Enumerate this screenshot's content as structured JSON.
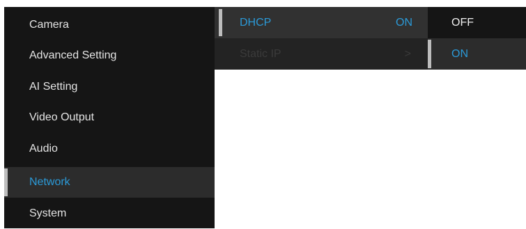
{
  "main_menu": {
    "items": [
      {
        "label": "Camera"
      },
      {
        "label": "Advanced Setting"
      },
      {
        "label": "AI Setting"
      },
      {
        "label": "Video Output"
      },
      {
        "label": "Audio"
      },
      {
        "label": "Network"
      },
      {
        "label": "System"
      }
    ],
    "selected": "Network"
  },
  "sub_menu": {
    "items": [
      {
        "label": "DHCP",
        "value": "ON"
      },
      {
        "label": "Static IP",
        "value": ">"
      }
    ],
    "selected": "DHCP"
  },
  "options": {
    "items": [
      {
        "label": "OFF"
      },
      {
        "label": "ON"
      }
    ],
    "selected": "ON"
  },
  "colors": {
    "accent": "#2b9ad8",
    "menu_background": "#151515",
    "submenu_background": "#232323",
    "selected_background": "#2c2c2c",
    "selection_bar": "#bdbdbd",
    "disabled_text": "#3b3b3b"
  }
}
